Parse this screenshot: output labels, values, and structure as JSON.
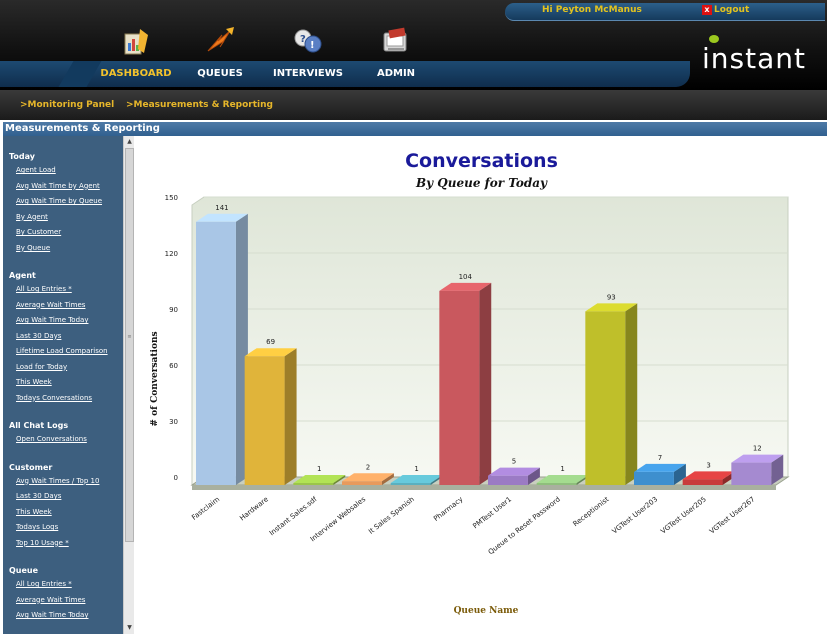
{
  "header": {
    "greeting": "Hi Peyton McManus",
    "logout_label": "Logout",
    "brand": "instant"
  },
  "nav": {
    "tabs": [
      {
        "label": "DASHBOARD",
        "icon": "dashboard-icon",
        "active": true
      },
      {
        "label": "QUEUES",
        "icon": "queues-icon",
        "active": false
      },
      {
        "label": "INTERVIEWS",
        "icon": "interviews-icon",
        "active": false
      },
      {
        "label": "ADMIN",
        "icon": "admin-icon",
        "active": false
      }
    ]
  },
  "subnav": {
    "items": [
      ">Monitoring Panel",
      ">Measurements & Reporting"
    ]
  },
  "section": {
    "title": "Measurements & Reporting"
  },
  "sidebar": {
    "groups": [
      {
        "title": "Today",
        "links": [
          "Agent Load",
          "Avg Wait Time by Agent",
          "Avg Wait Time by Queue",
          "By Agent",
          "By Customer",
          "By Queue"
        ]
      },
      {
        "title": "Agent",
        "links": [
          "All Log Entries *",
          "Average Wait Times",
          "Avg Wait Time Today",
          "Last 30 Days",
          "Lifetime Load Comparison",
          "Load for Today",
          "This Week",
          "Todays Conversations"
        ]
      },
      {
        "title": "All Chat Logs",
        "links": [
          "Open Conversations"
        ]
      },
      {
        "title": "Customer",
        "links": [
          "Avg Wait Times / Top 10",
          "Last 30 Days",
          "This Week",
          "Todays Logs",
          "Top 10 Usage *"
        ]
      },
      {
        "title": "Queue",
        "links": [
          "All Log Entries *",
          "Average Wait Times",
          "Avg Wait Time Today"
        ]
      }
    ]
  },
  "chart_data": {
    "type": "bar",
    "title": "Conversations",
    "subtitle": "By Queue for Today",
    "xlabel": "Queue Name",
    "ylabel": "# of Conversations",
    "ylim": [
      0,
      150
    ],
    "yticks": [
      0,
      30,
      60,
      90,
      120,
      150
    ],
    "categories": [
      "Fastclaim",
      "Hardware",
      "Instant Sales.sdf",
      "Interview Websales",
      "It Sales Spanish",
      "Pharmacy",
      "PMTest User1",
      "Queue to Reset Password",
      "Receptionist",
      "VGTest User203",
      "VGTest User205",
      "VGTest User267"
    ],
    "values": [
      141,
      69,
      1,
      2,
      1,
      104,
      5,
      1,
      93,
      7,
      3,
      12
    ],
    "colors": [
      "#a9c6e6",
      "#e0b43a",
      "#9bc54a",
      "#e89a5c",
      "#5ab0bf",
      "#c9585e",
      "#9b7bc4",
      "#8fbf7c",
      "#bfbf2a",
      "#3e8fce",
      "#c83b3b",
      "#a58ad0"
    ],
    "grid": true,
    "legend": "none"
  }
}
